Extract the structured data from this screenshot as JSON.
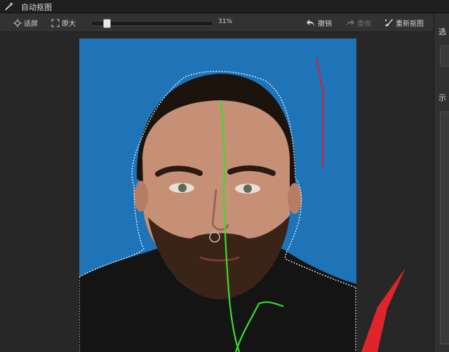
{
  "window": {
    "title": "自动抠图",
    "app_icon": "wand-icon"
  },
  "toolbar": {
    "fit_screen_label": "适屏",
    "original_size_label": "原大",
    "zoom_value": "31%",
    "zoom_fraction": 0.31,
    "undo_label": "撤销",
    "redo_label": "重做",
    "recut_label": "重新抠图"
  },
  "right_panel": {
    "section1_label": "选",
    "section2_label": "示"
  },
  "colors": {
    "canvas_background": "#1f74b8",
    "keep_stroke": "#3bdc2a",
    "remove_stroke": "#c8283a",
    "arrow": "#e0242c"
  }
}
